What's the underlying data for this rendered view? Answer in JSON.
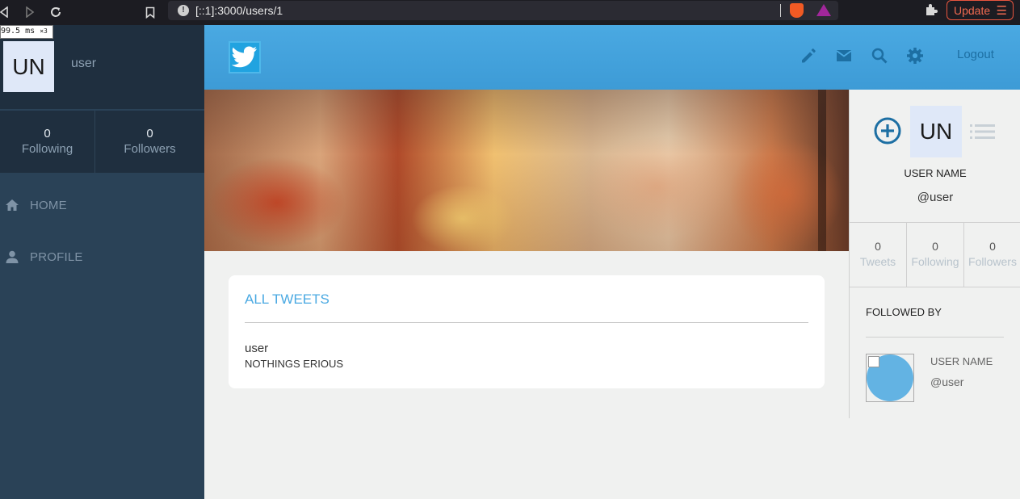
{
  "browser": {
    "url": "[::1]:3000/users/1",
    "update_label": "Update",
    "perf_badge": "99.5 ms",
    "perf_multiplier": "×3",
    "icons": [
      "back-icon",
      "forward-icon",
      "reload-icon",
      "bookmark-icon",
      "site-info-icon",
      "brave-shields-icon",
      "brave-rewards-icon",
      "extensions-icon",
      "menu-icon"
    ]
  },
  "sidebar": {
    "avatar_initials": "UN",
    "username": "user",
    "stats": [
      {
        "value": "0",
        "label": "Following"
      },
      {
        "value": "0",
        "label": "Followers"
      }
    ],
    "nav": [
      {
        "label": "HOME",
        "icon": "home-icon"
      },
      {
        "label": "PROFILE",
        "icon": "person-icon"
      }
    ]
  },
  "header": {
    "logo_icon": "twitter-bird-icon",
    "icons": [
      "pencil-icon",
      "mail-icon",
      "search-icon",
      "gear-icon"
    ],
    "logout_label": "Logout",
    "accent_color": "#4aa9e2"
  },
  "feed": {
    "title": "ALL TWEETS",
    "tweets": [
      {
        "user": "user",
        "text": "NOTHINGS ERIOUS"
      }
    ]
  },
  "profile_panel": {
    "avatar_initials": "UN",
    "name": "USER NAME",
    "handle": "@user",
    "stats": [
      {
        "value": "0",
        "label": "Tweets"
      },
      {
        "value": "0",
        "label": "Following"
      },
      {
        "value": "0",
        "label": "Followers"
      }
    ],
    "followed_by_title": "FOLLOWED BY",
    "followers": [
      {
        "name": "USER NAME",
        "handle": "@user"
      }
    ]
  }
}
